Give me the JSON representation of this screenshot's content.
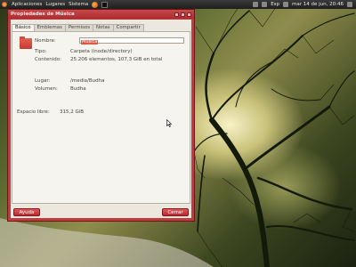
{
  "panel": {
    "menus": [
      "Aplicaciones",
      "Lugares",
      "Sistema"
    ],
    "keyboard_layout": "Esp",
    "clock": "mar 14 de jun, 20:46"
  },
  "window": {
    "title": "Propiedades de Música",
    "tabs": [
      "Básico",
      "Emblemas",
      "Permisos",
      "Notas",
      "Compartir"
    ],
    "active_tab": "Básico",
    "fields": {
      "name_label": "Nombre:",
      "name_value": "Música",
      "type_label": "Tipo:",
      "type_value": "Carpeta (inode/directory)",
      "content_label": "Contenido:",
      "content_value": "25.206 elementos, 107,3 GiB en total",
      "location_label": "Lugar:",
      "location_value": "/media/Budha",
      "volume_label": "Volumen:",
      "volume_value": "Budha",
      "free_label": "Espacio libre:",
      "free_value": "315,2 GiB"
    },
    "buttons": {
      "help": "Ayuda",
      "close": "Cerrar"
    }
  },
  "icons": {
    "folder": "folder-icon",
    "cursor": "mouse-pointer-icon"
  },
  "colors": {
    "window_frame": "#c03b3e",
    "accent": "#e4583f",
    "panel": "#2a2a2a"
  }
}
